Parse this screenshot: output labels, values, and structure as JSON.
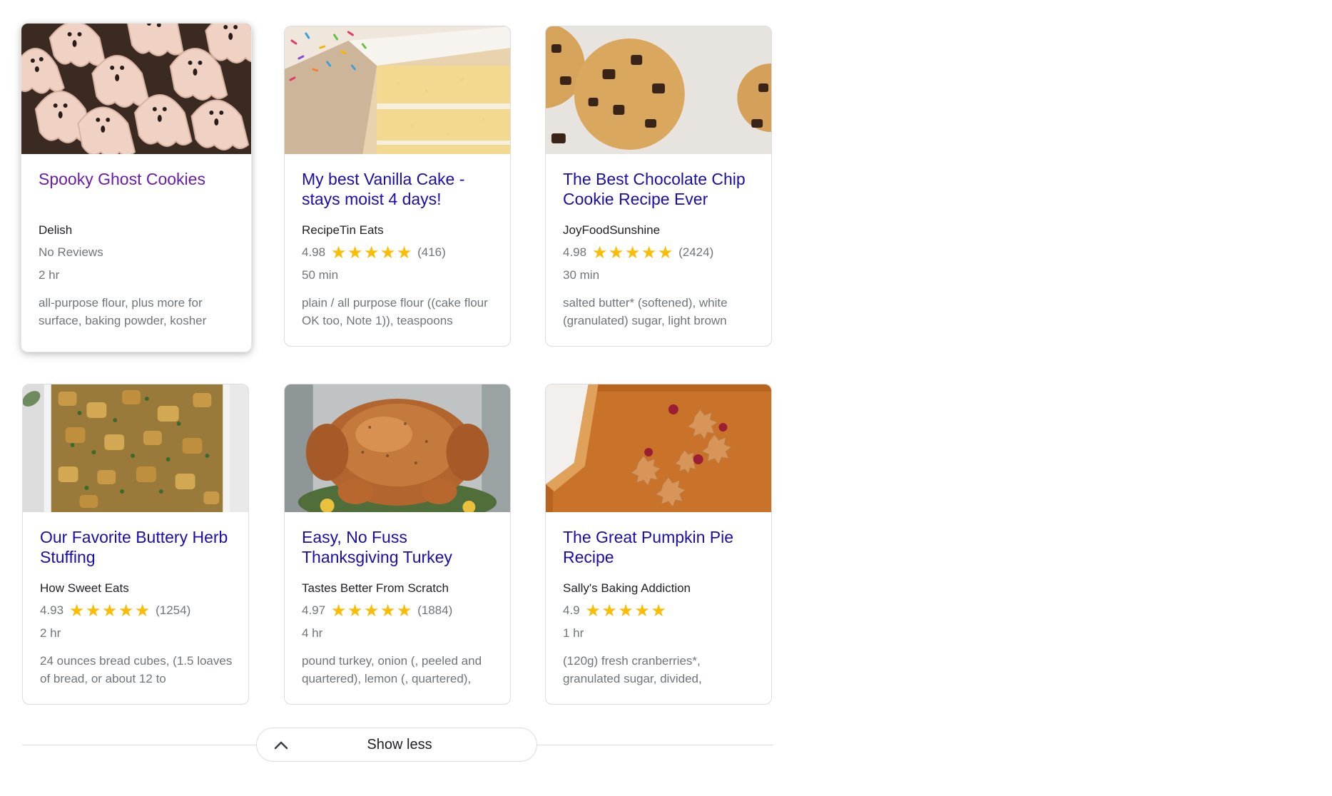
{
  "colors": {
    "link": "#1a0dab",
    "visited_link": "#681da8",
    "star": "#fbbc04",
    "muted_text": "#70757a",
    "border": "#dadce0"
  },
  "cards": [
    {
      "title": "Spooky Ghost Cookies",
      "source": "Delish",
      "rating": "",
      "reviews": "",
      "no_reviews_label": "No Reviews",
      "time": "2 hr",
      "ingredients": "all-purpose flour, plus more for surface, baking powder, kosher",
      "image": "ghost-cookies-image"
    },
    {
      "title": "My best Vanilla Cake - stays moist 4 days!",
      "source": "RecipeTin Eats",
      "rating": "4.98",
      "reviews": "(416)",
      "time": "50 min",
      "ingredients": "plain / all purpose flour ((cake flour OK too, Note 1)), teaspoons",
      "image": "vanilla-cake-image"
    },
    {
      "title": "The Best Chocolate Chip Cookie Recipe Ever",
      "source": "JoyFoodSunshine",
      "rating": "4.98",
      "reviews": "(2424)",
      "time": "30 min",
      "ingredients": "salted butter* (softened), white (granulated) sugar, light brown",
      "image": "chocolate-chip-cookie-image"
    },
    {
      "title": "Our Favorite Buttery Herb Stuffing",
      "source": "How Sweet Eats",
      "rating": "4.93",
      "reviews": "(1254)",
      "time": "2 hr",
      "ingredients": "24 ounces bread cubes, (1.5 loaves of bread, or about 12 to",
      "image": "herb-stuffing-image"
    },
    {
      "title": "Easy, No Fuss Thanksgiving Turkey",
      "source": "Tastes Better From Scratch",
      "rating": "4.97",
      "reviews": "(1884)",
      "time": "4 hr",
      "ingredients": "pound turkey, onion (, peeled and quartered), lemon (, quartered),",
      "image": "thanksgiving-turkey-image"
    },
    {
      "title": "The Great Pumpkin Pie Recipe",
      "source": "Sally's Baking Addiction",
      "rating": "4.9",
      "reviews": "",
      "time": "1 hr",
      "ingredients": "(120g) fresh cranberries*, granulated sugar, divided,",
      "image": "pumpkin-pie-image"
    }
  ],
  "show_less": {
    "label": "Show less"
  }
}
